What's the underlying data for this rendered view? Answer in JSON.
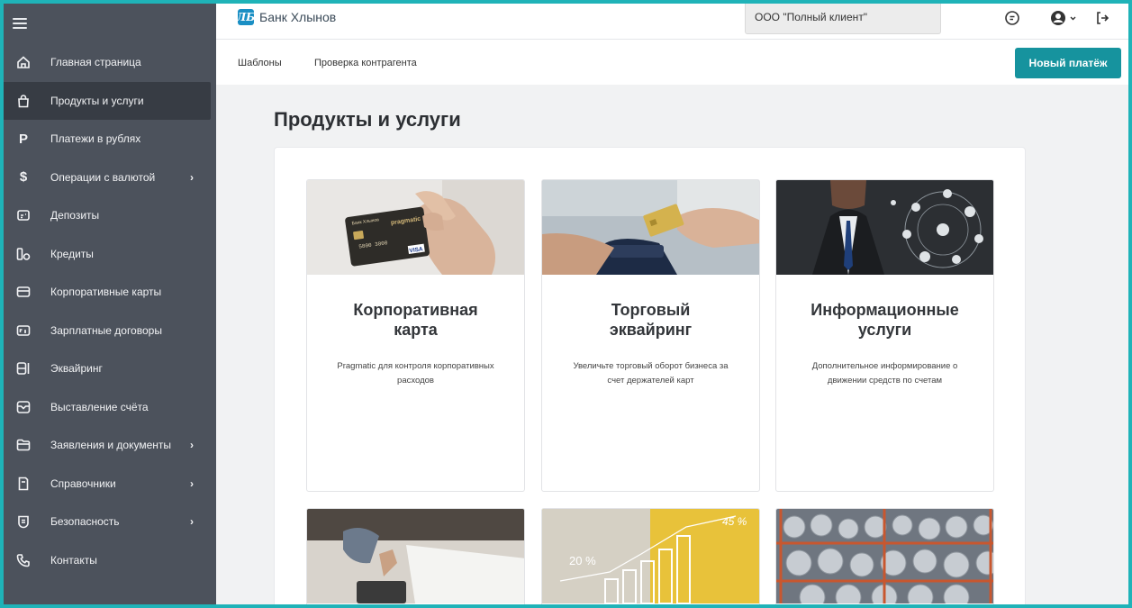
{
  "header": {
    "bank_name": "Банк Хлынов",
    "logo_letters": "ЛБ",
    "organization": "ООО \"Полный клиент\""
  },
  "sidebar": {
    "items": [
      {
        "label": "Главная страница",
        "icon": "home-icon"
      },
      {
        "label": "Продукты и услуги",
        "icon": "bag-icon",
        "active": true
      },
      {
        "label": "Платежи в рублях",
        "icon": "ruble-icon"
      },
      {
        "label": "Операции с валютой",
        "icon": "dollar-icon",
        "arrow": "›"
      },
      {
        "label": "Депозиты",
        "icon": "deposit-icon"
      },
      {
        "label": "Кредиты",
        "icon": "credit-icon"
      },
      {
        "label": "Корпоративные карты",
        "icon": "card-icon"
      },
      {
        "label": "Зарплатные договоры",
        "icon": "payroll-icon"
      },
      {
        "label": "Эквайринг",
        "icon": "terminal-icon"
      },
      {
        "label": "Выставление счёта",
        "icon": "invoice-icon"
      },
      {
        "label": "Заявления и документы",
        "icon": "folder-icon",
        "arrow": "›"
      },
      {
        "label": "Справочники",
        "icon": "book-icon",
        "arrow": "›"
      },
      {
        "label": "Безопасность",
        "icon": "shield-icon",
        "arrow": "›"
      },
      {
        "label": "Контакты",
        "icon": "phone-icon"
      }
    ]
  },
  "subnav": {
    "templates": "Шаблоны",
    "counterparty_check": "Проверка контрагента",
    "new_payment": "Новый платёж"
  },
  "main": {
    "title": "Продукты и услуги",
    "cards": [
      {
        "title_line1": "Корпоративная",
        "title_line2": "карта",
        "desc_line1": "Pragmatic для контроля корпоративных",
        "desc_line2": "расходов",
        "card_brand": "pragmatic",
        "card_number": "5800 3800",
        "card_logo": "VISA",
        "card_bank": "Банк Хлынов"
      },
      {
        "title_line1": "Торговый",
        "title_line2": "эквайринг",
        "desc_line1": "Увеличьте торговый оборот бизнеса за",
        "desc_line2": "счет держателей карт"
      },
      {
        "title_line1": "Информационные",
        "title_line2": "услуги",
        "desc_line1": "Дополнительное информирование о",
        "desc_line2": "движении средств по счетам"
      }
    ],
    "chart_image_labels": [
      "20 %",
      "45 %"
    ]
  }
}
